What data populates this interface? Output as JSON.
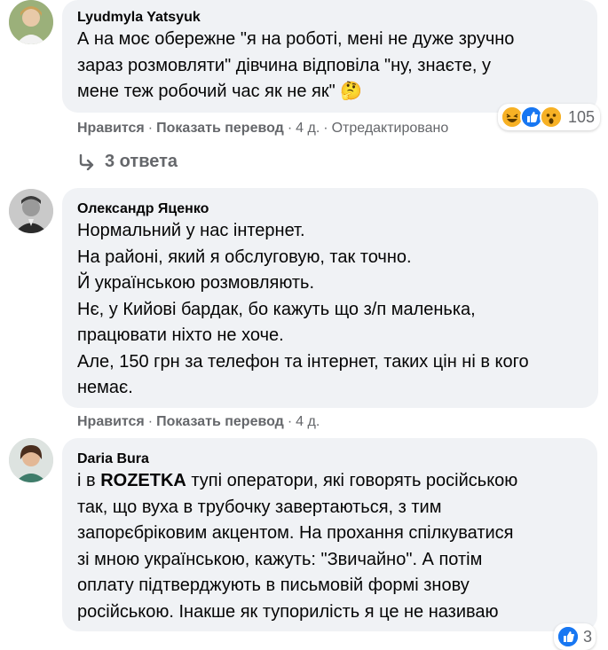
{
  "comments": [
    {
      "author": "Lyudmyla Yatsyuk",
      "lines": [
        "А на моє обережне \"я на роботі, мені не дуже зручно",
        "зараз розмовляти\" дівчина відповіла \"ну, знаєте, у",
        "мене теж робочий час як не як\""
      ],
      "emoji": "🤔",
      "like_label": "Нравится",
      "translate_label": "Показать перевод",
      "time": "4 д.",
      "edited": "Отредактировано",
      "reaction_count": "105",
      "replies_label": "3 ответа"
    },
    {
      "author": "Олександр Яценко",
      "lines": [
        "Нормальний у нас інтернет.",
        "На районі, який я обслуговую, так точно.",
        "Й українською розмовляють.",
        "Нє, у Кийові бардак, бо кажуть що з/п маленька,",
        "працювати ніхто не хоче.",
        "Але, 150 грн за телефон та інтернет, таких цін ні в кого",
        "немає."
      ],
      "like_label": "Нравится",
      "translate_label": "Показать перевод",
      "time": "4 д."
    },
    {
      "author": "Daria Bura",
      "line1_prefix": "і в ",
      "line1_brand": "ROZETKA",
      "line1_suffix": " тупі оператори, які говорять російською",
      "lines": [
        "так, що вуха в трубочку завертаються, з тим",
        "запорєбріковим акцентом. На прохання спілкуватися",
        "зі мною українською, кажуть: \"Звичайно\". А потім",
        "оплату підтверджують в письмовій формі знову",
        "російською. Інакше як тупорилість я це не називаю"
      ],
      "reaction_count": "3"
    }
  ],
  "colors": {
    "bubble": "#f0f2f5",
    "meta": "#65676b",
    "like_blue": "#1877f2",
    "haha_yellow": "#f7b125"
  }
}
